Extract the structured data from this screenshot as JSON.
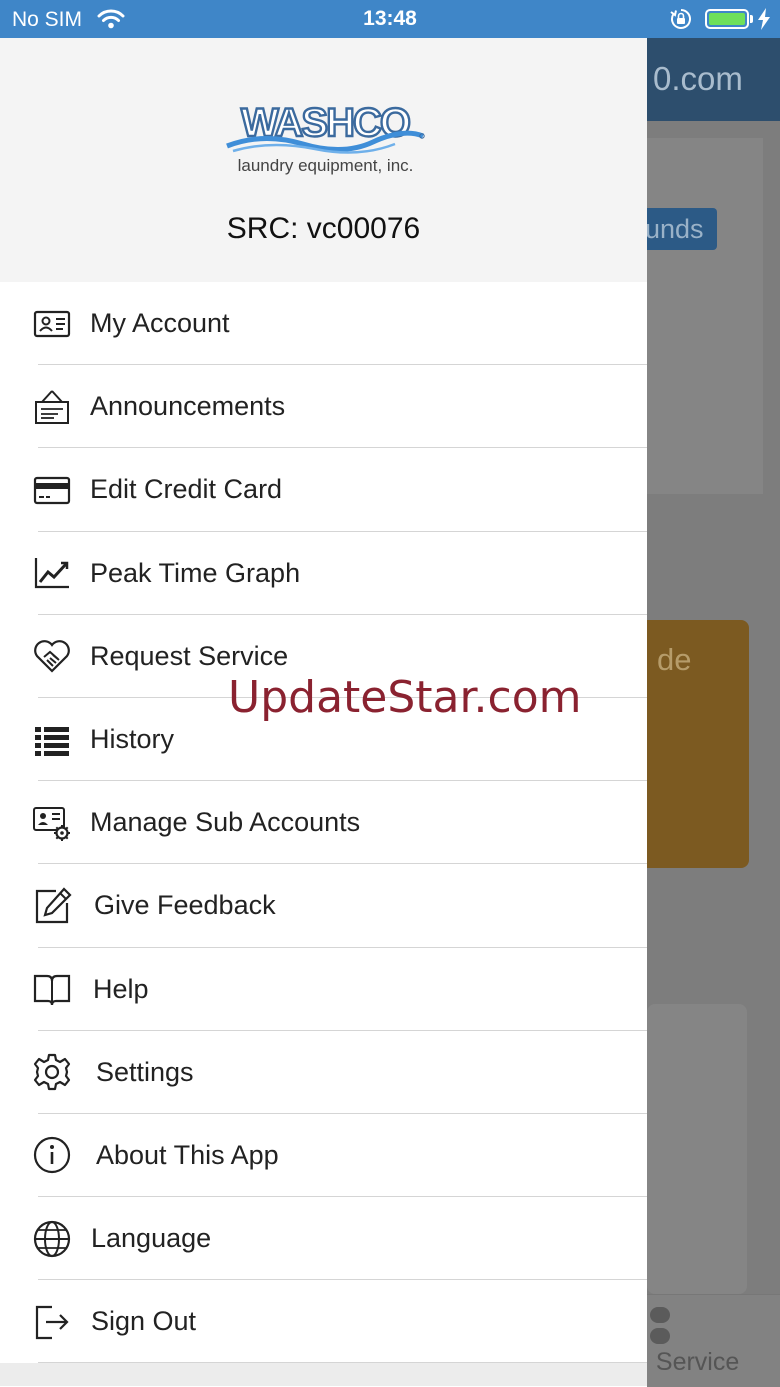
{
  "status_bar": {
    "carrier": "No SIM",
    "time": "13:48",
    "battery_color": "#6ee05a"
  },
  "background_app": {
    "header_text": "0.com",
    "funds_button": "unds",
    "card_text": "de",
    "tab_label": ": Service"
  },
  "drawer": {
    "logo": {
      "brand": "WASHCO",
      "tagline": "laundry equipment, inc.",
      "brand_color": "#3b6a9e",
      "wave_color": "#3f8ed8"
    },
    "src": "SRC: vc00076",
    "items": [
      {
        "label": "My Account",
        "icon": "id-card-icon"
      },
      {
        "label": "Announcements",
        "icon": "announcement-sign-icon"
      },
      {
        "label": "Edit Credit Card",
        "icon": "credit-card-icon"
      },
      {
        "label": "Peak Time Graph",
        "icon": "line-chart-icon"
      },
      {
        "label": "Request Service",
        "icon": "handshake-heart-icon"
      },
      {
        "label": "History",
        "icon": "list-icon"
      },
      {
        "label": "Manage Sub Accounts",
        "icon": "user-settings-icon"
      },
      {
        "label": "Give Feedback",
        "icon": "edit-pencil-icon"
      },
      {
        "label": "Help",
        "icon": "book-icon"
      },
      {
        "label": "Settings",
        "icon": "gear-icon"
      },
      {
        "label": "About This App",
        "icon": "info-icon"
      },
      {
        "label": "Language",
        "icon": "globe-icon"
      },
      {
        "label": "Sign Out",
        "icon": "sign-out-icon"
      }
    ]
  },
  "watermark": "UpdateStar.com"
}
